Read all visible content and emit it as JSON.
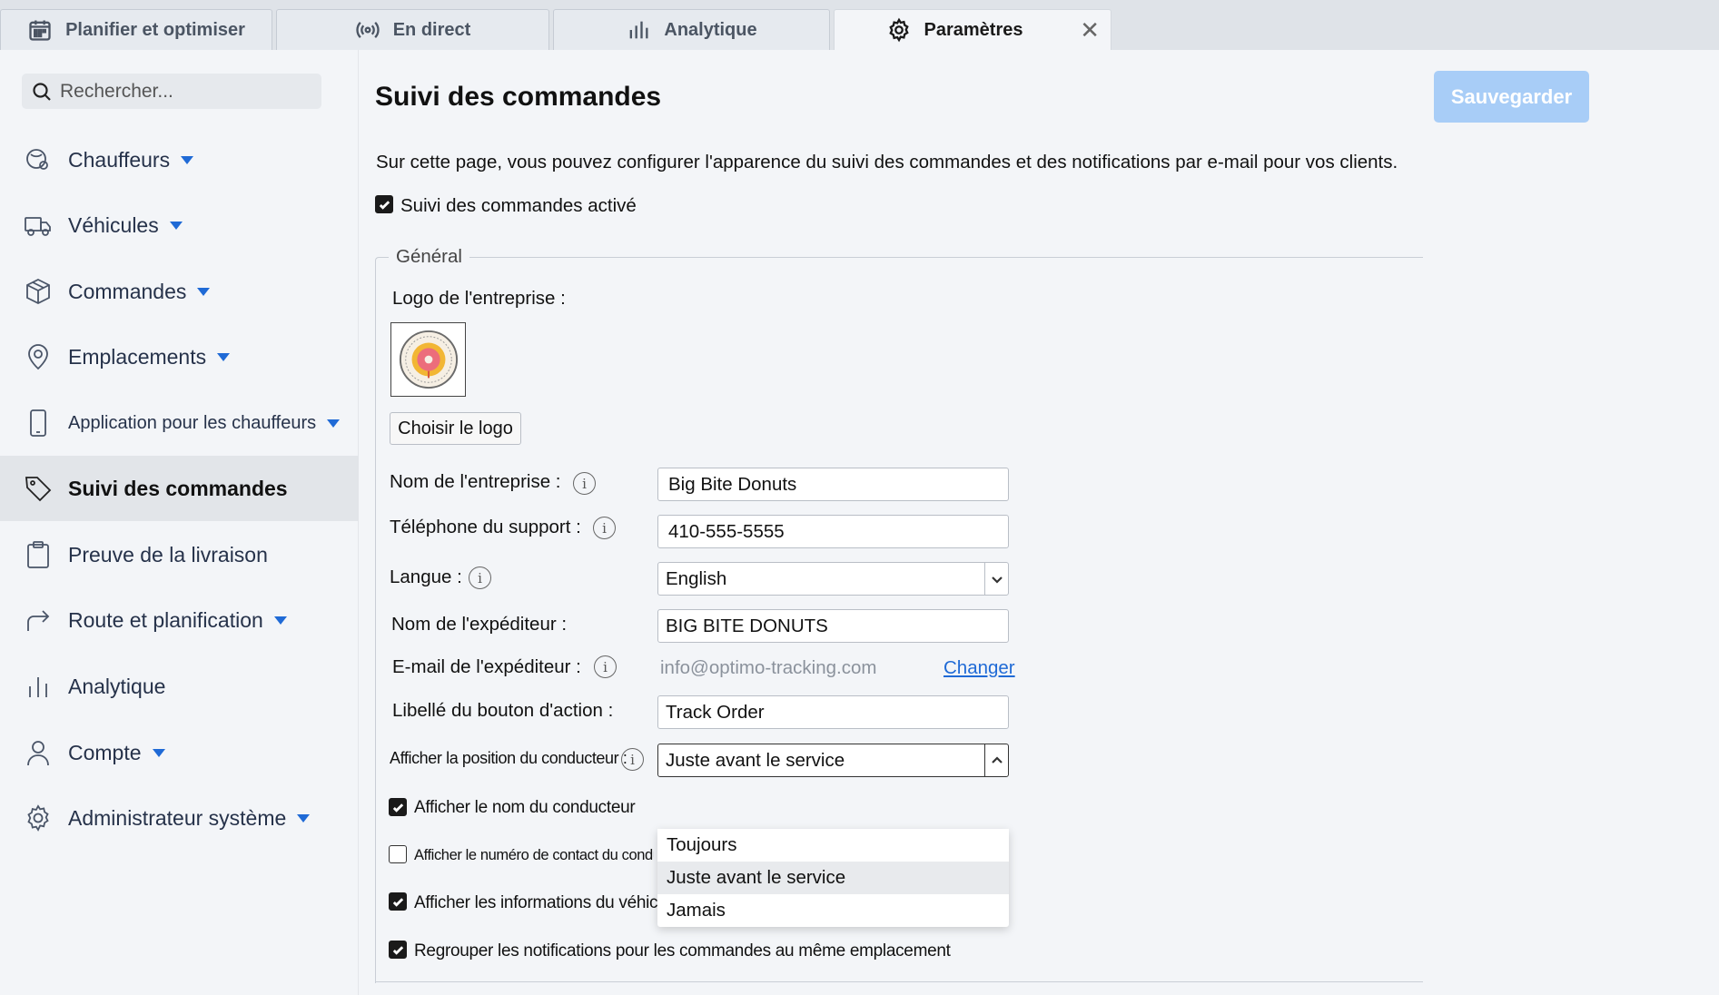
{
  "tabs": [
    {
      "label": "Planifier et optimiser",
      "icon": "calendar-icon"
    },
    {
      "label": "En direct",
      "icon": "broadcast-icon"
    },
    {
      "label": "Analytique",
      "icon": "bar-chart-icon"
    },
    {
      "label": "Paramètres",
      "icon": "gear-icon",
      "active": true
    }
  ],
  "tab_close": "✕",
  "sidebar": {
    "search_placeholder": "Rechercher...",
    "items": [
      {
        "label": "Chauffeurs",
        "icon": "driver-icon",
        "has_caret": true
      },
      {
        "label": "Véhicules",
        "icon": "truck-icon",
        "has_caret": true
      },
      {
        "label": "Commandes",
        "icon": "package-icon",
        "has_caret": true
      },
      {
        "label": "Emplacements",
        "icon": "location-pin-icon",
        "has_caret": true
      },
      {
        "label": "Application pour les chauffeurs",
        "icon": "phone-icon",
        "has_caret": true
      },
      {
        "label": "Suivi des commandes",
        "icon": "tag-icon",
        "active": true
      },
      {
        "label": "Preuve de la livraison",
        "icon": "clipboard-icon"
      },
      {
        "label": "Route et planification",
        "icon": "route-arrow-icon",
        "has_caret": true
      },
      {
        "label": "Analytique",
        "icon": "analytics-icon"
      },
      {
        "label": "Compte",
        "icon": "user-icon",
        "has_caret": true
      },
      {
        "label": "Administrateur système",
        "icon": "settings-icon",
        "has_caret": true
      }
    ]
  },
  "main": {
    "title": "Suivi des commandes",
    "save_label": "Sauvegarder",
    "intro": "Sur cette page, vous pouvez configurer l'apparence du suivi des commandes et des notifications par e-mail pour vos clients.",
    "tracking_enabled_label": "Suivi des commandes activé",
    "general_legend": "Général",
    "logo_label": "Logo de l'entreprise :",
    "choose_logo": "Choisir le logo",
    "company_name_label": "Nom de l'entreprise :",
    "company_name_value": "Big Bite Donuts",
    "support_phone_label": "Téléphone du support :",
    "support_phone_value": "410-555-5555",
    "language_label": "Langue :",
    "language_value": "English",
    "sender_name_label": "Nom de l'expéditeur :",
    "sender_name_value": "BIG BITE DONUTS",
    "sender_email_label": "E-mail de l'expéditeur :",
    "sender_email_value": "info@optimo-tracking.com",
    "change_link": "Changer",
    "action_button_label": "Libellé du bouton d'action :",
    "action_button_value": "Track Order",
    "driver_position_label": "Afficher la position du conducteur :",
    "driver_position_value": "Juste avant le service",
    "driver_position_options": [
      "Toujours",
      "Juste avant le service",
      "Jamais"
    ],
    "show_driver_name_label": "Afficher le nom du conducteur",
    "show_driver_contact_label": "Afficher le numéro de contact du conducte",
    "show_vehicle_info_label": "Afficher les informations du véhicule",
    "group_notifications_label": "Regrouper les notifications pour les commandes au même emplacement"
  },
  "colors": {
    "accent": "#1f6ad6",
    "save_button": "#a8cdf7"
  }
}
